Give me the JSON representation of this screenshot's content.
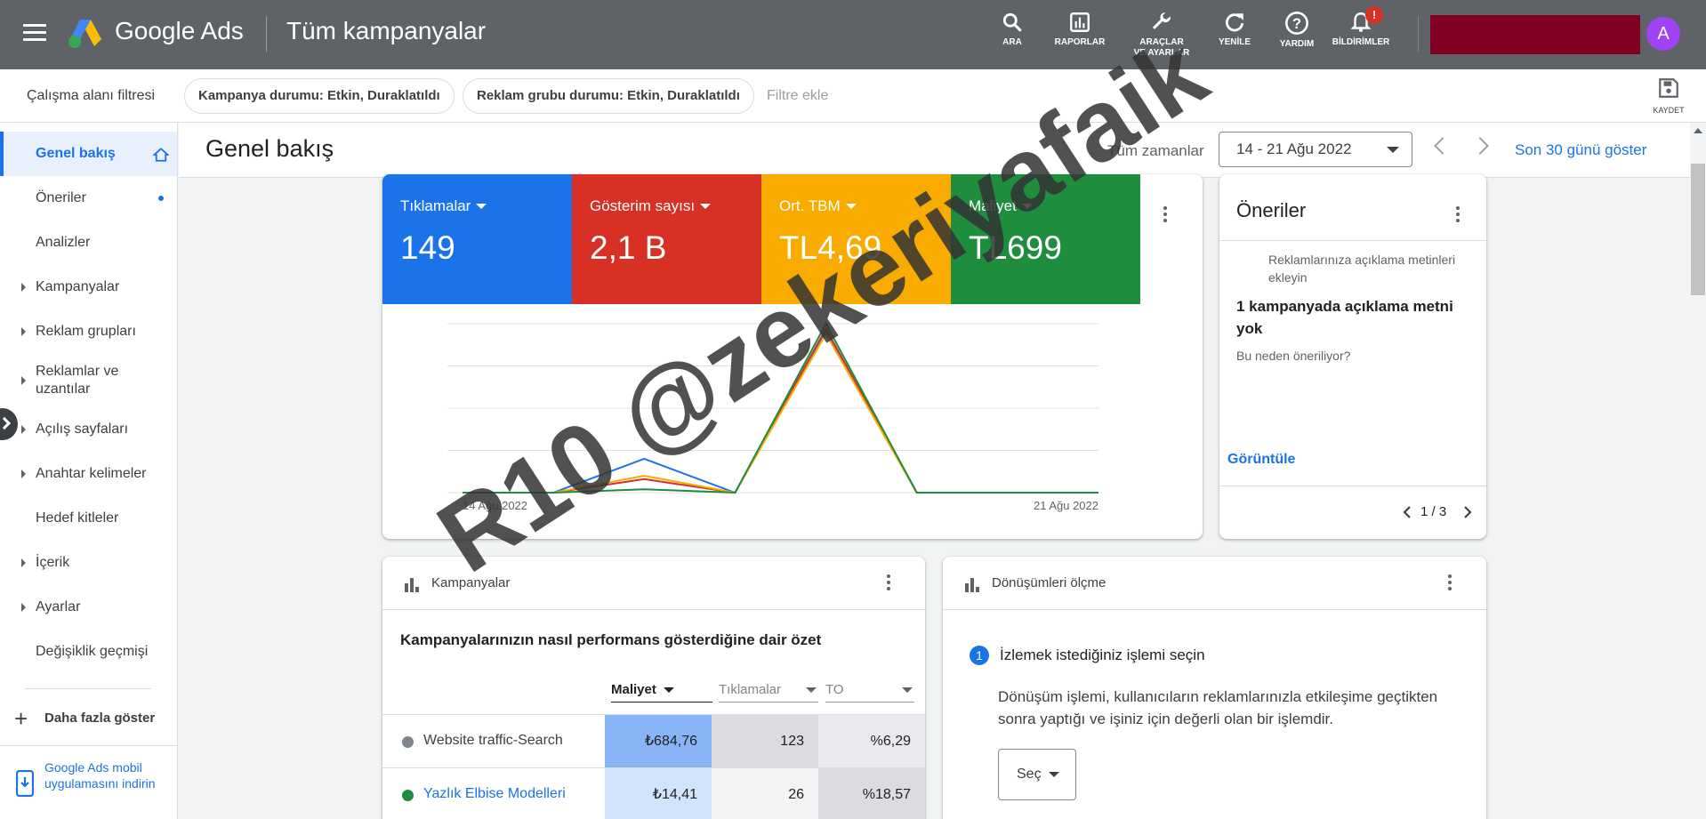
{
  "topbar": {
    "brand": "Google Ads",
    "page_title": "Tüm kampanyalar",
    "tools": [
      {
        "label": "ARA",
        "icon": "search-icon"
      },
      {
        "label": "RAPORLAR",
        "icon": "reports-icon"
      },
      {
        "label": "ARAÇLAR\nVE AYARLAR",
        "icon": "wrench-icon"
      },
      {
        "label": "YENİLE",
        "icon": "refresh-icon"
      },
      {
        "label": "YARDIM",
        "icon": "help-icon"
      },
      {
        "label": "BİLDİRİMLER",
        "icon": "bell-icon"
      }
    ],
    "notification_badge": "!",
    "avatar_letter": "A",
    "account_color": "#820021"
  },
  "filterbar": {
    "label": "Çalışma alanı filtresi",
    "chips": [
      "Kampanya durumu: Etkin, Duraklatıldı",
      "Reklam grubu durumu: Etkin, Duraklatıldı"
    ],
    "add_filter": "Filtre ekle",
    "save_label": "KAYDET"
  },
  "sidebar": {
    "items": [
      {
        "label": "Genel bakış"
      },
      {
        "label": "Öneriler"
      },
      {
        "label": "Analizler"
      },
      {
        "label": "Kampanyalar"
      },
      {
        "label": "Reklam grupları"
      },
      {
        "label": "Reklamlar ve uzantılar"
      },
      {
        "label": "Açılış sayfaları"
      },
      {
        "label": "Anahtar kelimeler"
      },
      {
        "label": "Hedef kitleler"
      },
      {
        "label": "İçerik"
      },
      {
        "label": "Ayarlar"
      },
      {
        "label": "Değişiklik geçmişi"
      }
    ],
    "more": "Daha fazla göster",
    "mobile_app": "Google Ads mobil uygulamasını indirin"
  },
  "header": {
    "title": "Genel bakış",
    "time_label": "Tüm zamanlar",
    "date_range": "14 - 21 Ağu 2022",
    "show_last": "Son 30 günü göster"
  },
  "metrics": [
    {
      "name": "Tıklamalar",
      "value": "149",
      "color": "#1a73e8"
    },
    {
      "name": "Gösterim sayısı",
      "value": "2,1 B",
      "color": "#d93025"
    },
    {
      "name": "Ort. TBM",
      "value": "TL4,69",
      "color": "#f9ab00"
    },
    {
      "name": "Maliyet",
      "value": "TL699",
      "color": "#1e8e3e"
    }
  ],
  "chart_data": {
    "type": "line",
    "x": [
      "14 Ağu 2022",
      "15 Ağu 2022",
      "16 Ağu 2022",
      "17 Ağu 2022",
      "18 Ağu 2022",
      "19 Ağu 2022",
      "20 Ağu 2022",
      "21 Ağu 2022"
    ],
    "x_tick_labels": [
      "14 Ağu 2022",
      "21 Ağu 2022"
    ],
    "series": [
      {
        "name": "Tıklamalar",
        "color": "#1a73e8",
        "values": [
          0,
          0,
          0.2,
          0,
          0.95,
          0,
          0,
          0
        ]
      },
      {
        "name": "Gösterim sayısı",
        "color": "#d93025",
        "values": [
          0,
          0,
          0.08,
          0,
          0.97,
          0,
          0,
          0
        ]
      },
      {
        "name": "Ort. TBM",
        "color": "#f9ab00",
        "values": [
          0,
          0,
          0.1,
          0,
          0.94,
          0,
          0,
          0
        ]
      },
      {
        "name": "Maliyet",
        "color": "#1e8e3e",
        "values": [
          0,
          0,
          0.02,
          0,
          1.0,
          0,
          0,
          0
        ]
      }
    ],
    "ylim": [
      0,
      1
    ],
    "grid": true
  },
  "oneriler": {
    "title": "Öneriler",
    "subtitle": "Reklamlarınıza açıklama metinleri ekleyin",
    "headline": "1 kampanyada açıklama metni yok",
    "why": "Bu neden öneriliyor?",
    "view": "Görüntüle",
    "pager": "1 / 3"
  },
  "kampanyalar": {
    "title": "Kampanyalar",
    "summary": "Kampanyalarınızın nasıl performans gösterdiğine dair özet",
    "columns": [
      "Maliyet",
      "Tıklamalar",
      "TO"
    ],
    "rows": [
      {
        "name": "Website traffic-Search",
        "cost": "₺684,76",
        "clicks": "123",
        "ctr": "%6,29",
        "status": "paused"
      },
      {
        "name": "Yazlık Elbise Modelleri",
        "cost": "₺14,41",
        "clicks": "26",
        "ctr": "%18,57",
        "status": "active"
      }
    ]
  },
  "donusum": {
    "title": "Dönüşümleri ölçme",
    "step_number": "1",
    "step_title": "İzlemek istediğiniz işlemi seçin",
    "description": "Dönüşüm işlemi, kullanıcıların reklamlarınızla etkileşime geçtikten sonra yaptığı ve işiniz için değerli olan bir işlemdir.",
    "select_label": "Seç"
  },
  "watermark": "R10 @zekeriyafaik"
}
